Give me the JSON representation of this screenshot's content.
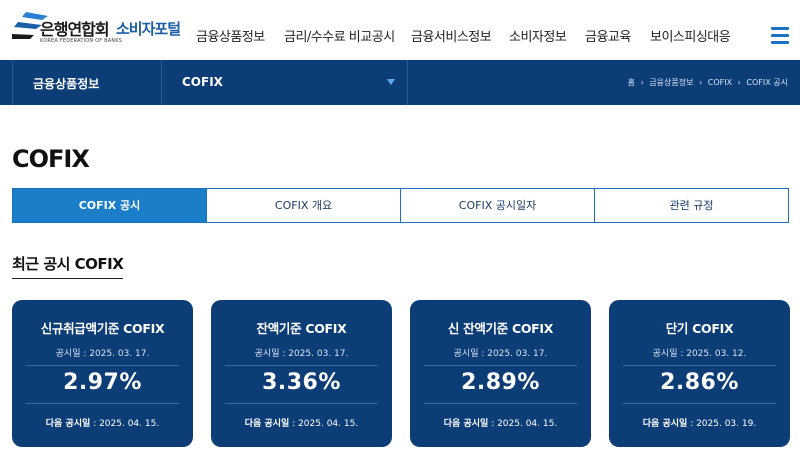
{
  "header": {
    "logo_kr": "은행연합회",
    "logo_en": "KOREA FEDERATION OF BANKS",
    "logo_portal": "소비자포털",
    "nav": [
      {
        "label": "금융상품정보"
      },
      {
        "label": "금리/수수료 비교공시"
      },
      {
        "label": "금융서비스정보"
      },
      {
        "label": "소비자정보"
      },
      {
        "label": "금융교육"
      },
      {
        "label": "보이스피싱대응"
      }
    ]
  },
  "subbar": {
    "section": "금융상품정보",
    "selected": "COFIX",
    "breadcrumb": [
      "홈",
      "금융상품정보",
      "COFIX",
      "COFIX 공시"
    ]
  },
  "page_title": "COFIX",
  "tabs": [
    {
      "label": "COFIX 공시",
      "active": true
    },
    {
      "label": "COFIX 개요",
      "active": false
    },
    {
      "label": "COFIX 공시일자",
      "active": false
    },
    {
      "label": "관련 규정",
      "active": false
    }
  ],
  "section_heading": "최근 공시 COFIX",
  "cards": [
    {
      "name": "신규취급액기준 COFIX",
      "date_label": "공시일 : 2025. 03. 17.",
      "rate": "2.97%",
      "next_label": "다음 공시일",
      "next_date": " : 2025. 04. 15."
    },
    {
      "name": "잔액기준 COFIX",
      "date_label": "공시일 : 2025. 03. 17.",
      "rate": "3.36%",
      "next_label": "다음 공시일",
      "next_date": " : 2025. 04. 15."
    },
    {
      "name": "신 잔액기준 COFIX",
      "date_label": "공시일 : 2025. 03. 17.",
      "rate": "2.89%",
      "next_label": "다음 공시일",
      "next_date": " : 2025. 04. 15."
    },
    {
      "name": "단기 COFIX",
      "date_label": "공시일 : 2025. 03. 12.",
      "rate": "2.86%",
      "next_label": "다음 공시일",
      "next_date": " : 2025. 03. 19."
    }
  ],
  "colors": {
    "navy": "#0c3d77",
    "tab_active": "#1b7ec9",
    "brand_blue": "#1b5fa6"
  }
}
